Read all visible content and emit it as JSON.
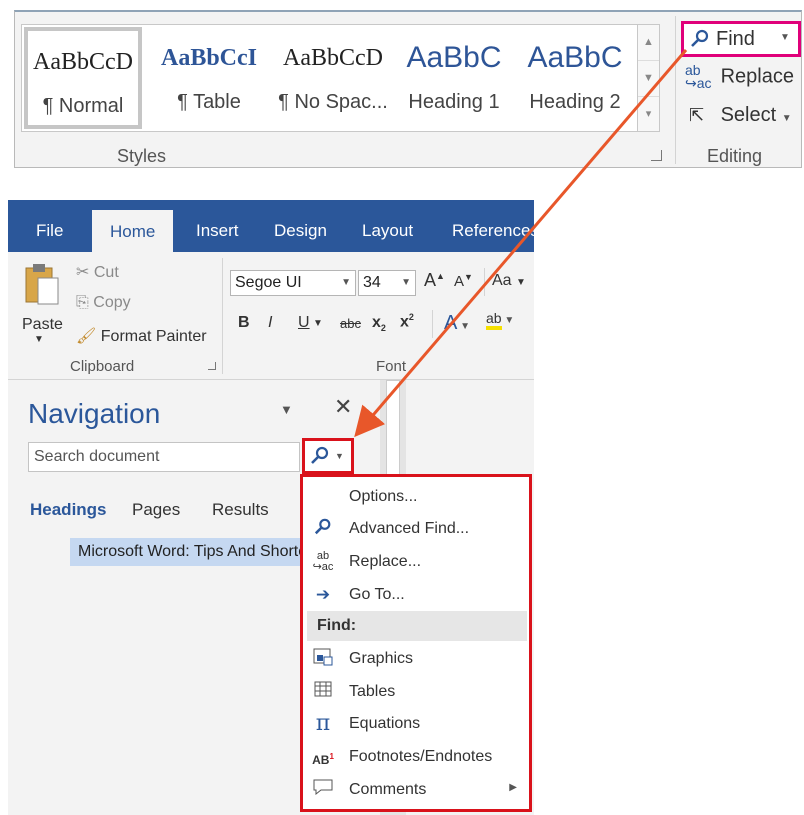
{
  "styles_group": {
    "label": "Styles",
    "tiles": [
      {
        "sample": "AaBbCcD",
        "name": "¶ Normal"
      },
      {
        "sample": "AaBbCcI",
        "name": "¶ Table"
      },
      {
        "sample": "AaBbCcD",
        "name": "¶ No Spac..."
      },
      {
        "sample": "AaBbC",
        "name": "Heading 1"
      },
      {
        "sample": "AaBbC",
        "name": "Heading 2"
      }
    ]
  },
  "editing_group": {
    "label": "Editing",
    "find": "Find",
    "replace": "Replace",
    "select": "Select"
  },
  "tabs": [
    "File",
    "Home",
    "Insert",
    "Design",
    "Layout",
    "References"
  ],
  "clipboard": {
    "label": "Clipboard",
    "paste": "Paste",
    "cut": "Cut",
    "copy": "Copy",
    "format_painter": "Format Painter"
  },
  "font": {
    "label": "Font",
    "family": "Segoe UI",
    "size": "34",
    "aa": "Aa"
  },
  "navigation": {
    "title": "Navigation",
    "search_placeholder": "Search document",
    "tabs": [
      "Headings",
      "Pages",
      "Results"
    ],
    "heading_item": "Microsoft Word: Tips And Shortcuts"
  },
  "menu": {
    "items_top": [
      "Options...",
      "Advanced Find...",
      "Replace...",
      "Go To..."
    ],
    "find_header": "Find:",
    "items_find": [
      "Graphics",
      "Tables",
      "Equations",
      "Footnotes/Endnotes",
      "Comments"
    ]
  },
  "colors": {
    "ribbon_blue": "#2b579a",
    "highlight_red": "#d9121b",
    "highlight_magenta": "#e0007a",
    "arrow_orange": "#e8572a"
  }
}
